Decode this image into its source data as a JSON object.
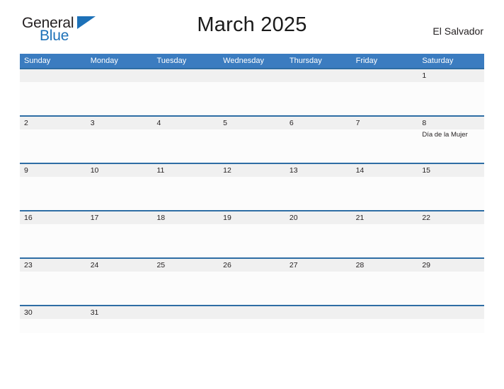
{
  "logo": {
    "part1": "General",
    "part2": "Blue",
    "flag_icon": "flag-triangle-icon"
  },
  "header": {
    "title": "March 2025",
    "country": "El Salvador"
  },
  "colors": {
    "header_blue": "#3b7cc0",
    "divider_blue": "#2e6da4",
    "band_gray": "#f0f0f0",
    "logo_blue": "#1d71b8",
    "text_dark": "#231f20"
  },
  "weekdays": [
    "Sunday",
    "Monday",
    "Tuesday",
    "Wednesday",
    "Thursday",
    "Friday",
    "Saturday"
  ],
  "weeks": [
    [
      {
        "day": ""
      },
      {
        "day": ""
      },
      {
        "day": ""
      },
      {
        "day": ""
      },
      {
        "day": ""
      },
      {
        "day": ""
      },
      {
        "day": "1"
      }
    ],
    [
      {
        "day": "2"
      },
      {
        "day": "3"
      },
      {
        "day": "4"
      },
      {
        "day": "5"
      },
      {
        "day": "6"
      },
      {
        "day": "7"
      },
      {
        "day": "8",
        "event": "Día de la Mujer"
      }
    ],
    [
      {
        "day": "9"
      },
      {
        "day": "10"
      },
      {
        "day": "11"
      },
      {
        "day": "12"
      },
      {
        "day": "13"
      },
      {
        "day": "14"
      },
      {
        "day": "15"
      }
    ],
    [
      {
        "day": "16"
      },
      {
        "day": "17"
      },
      {
        "day": "18"
      },
      {
        "day": "19"
      },
      {
        "day": "20"
      },
      {
        "day": "21"
      },
      {
        "day": "22"
      }
    ],
    [
      {
        "day": "23"
      },
      {
        "day": "24"
      },
      {
        "day": "25"
      },
      {
        "day": "26"
      },
      {
        "day": "27"
      },
      {
        "day": "28"
      },
      {
        "day": "29"
      }
    ],
    [
      {
        "day": "30"
      },
      {
        "day": "31"
      },
      {
        "day": ""
      },
      {
        "day": ""
      },
      {
        "day": ""
      },
      {
        "day": ""
      },
      {
        "day": ""
      }
    ]
  ]
}
